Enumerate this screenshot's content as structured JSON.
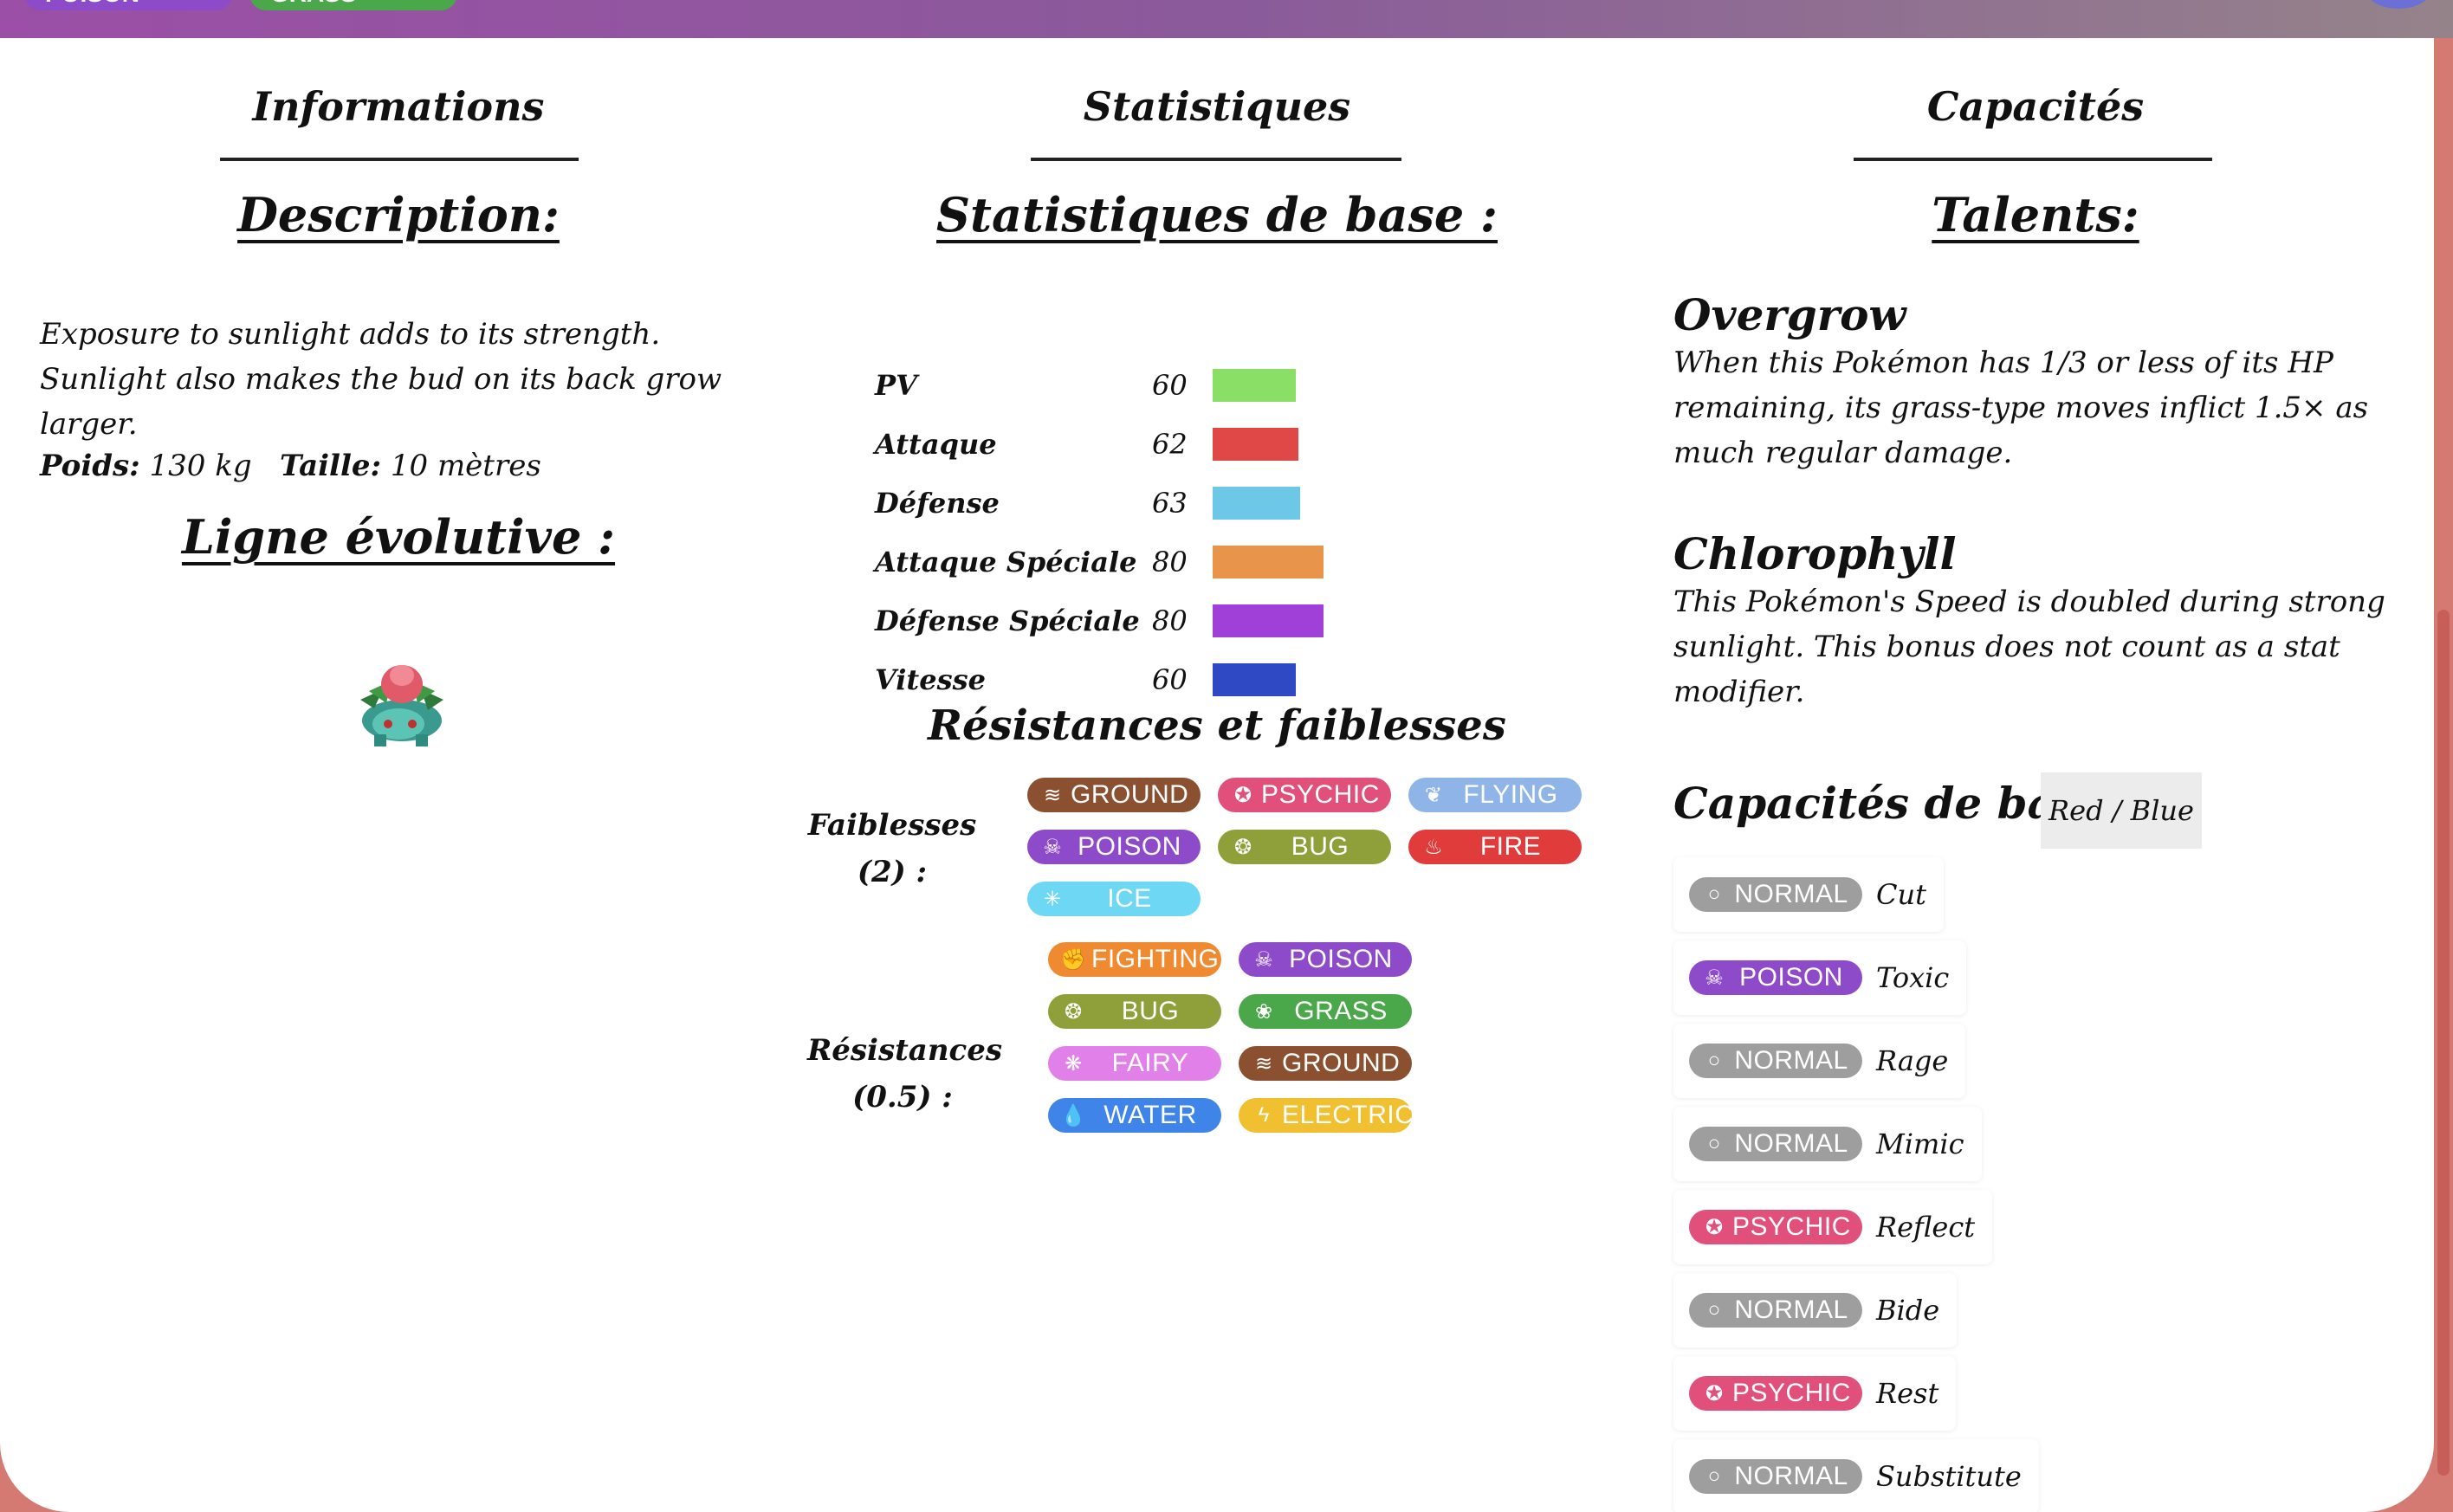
{
  "header": {
    "type_chips": [
      {
        "label": "POISON",
        "color": "#8e4bc9"
      },
      {
        "label": "GRASS",
        "color": "#4aa84a"
      }
    ]
  },
  "columns": {
    "info": {
      "title": "Informations",
      "description_title": "Description:",
      "description": "Exposure to sunlight adds to its strength. Sunlight also makes the bud on its back grow larger.",
      "weight_label": "Poids:",
      "weight_value": "130 kg",
      "height_label": "Taille:",
      "height_value": "10 mètres",
      "evolution_title": "Ligne évolutive :"
    },
    "stats": {
      "title": "Statistiques",
      "base_title": "Statistiques de base :",
      "rows": [
        {
          "name": "PV",
          "value": "60",
          "color": "#8ae066"
        },
        {
          "name": "Attaque",
          "value": "62",
          "color": "#e04848"
        },
        {
          "name": "Défense",
          "value": "63",
          "color": "#6cc8e6"
        },
        {
          "name": "Attaque Spéciale",
          "value": "80",
          "color": "#e8944a"
        },
        {
          "name": "Défense Spéciale",
          "value": "80",
          "color": "#a040d8"
        },
        {
          "name": "Vitesse",
          "value": "60",
          "color": "#2f48c4"
        }
      ],
      "res_title": "Résistances et faiblesses",
      "weak_label_1": "Faiblesses",
      "weak_label_2": "(2) :",
      "weaknesses": [
        {
          "label": "GROUND",
          "color": "#8a5030",
          "icon": "ground-icon"
        },
        {
          "label": "PSYCHIC",
          "color": "#e0507a",
          "icon": "psychic-icon"
        },
        {
          "label": "FLYING",
          "color": "#8fb4e8",
          "icon": "flying-icon"
        },
        {
          "label": "POISON",
          "color": "#8e4bc9",
          "icon": "poison-icon"
        },
        {
          "label": "BUG",
          "color": "#8fa03a",
          "icon": "bug-icon"
        },
        {
          "label": "FIRE",
          "color": "#e03c3c",
          "icon": "fire-icon"
        },
        {
          "label": "ICE",
          "color": "#6ed8f4",
          "icon": "ice-icon"
        }
      ],
      "resist_label_1": "Résistances",
      "resist_label_2": "(0.5) :",
      "resistances": [
        {
          "label": "FIGHTING",
          "color": "#f08a30",
          "icon": "fighting-icon"
        },
        {
          "label": "POISON",
          "color": "#8e4bc9",
          "icon": "poison-icon"
        },
        {
          "label": "BUG",
          "color": "#8fa03a",
          "icon": "bug-icon"
        },
        {
          "label": "GRASS",
          "color": "#4aa84a",
          "icon": "grass-icon"
        },
        {
          "label": "FAIRY",
          "color": "#e080e8",
          "icon": "fairy-icon"
        },
        {
          "label": "GROUND",
          "color": "#8a5030",
          "icon": "ground-icon"
        },
        {
          "label": "WATER",
          "color": "#3f84e8",
          "icon": "water-icon"
        },
        {
          "label": "ELECTRIC",
          "color": "#f0c030",
          "icon": "electric-icon"
        }
      ]
    },
    "abilities": {
      "title": "Capacités",
      "talents_title": "Talents:",
      "talents": [
        {
          "name": "Overgrow",
          "desc": "When this Pokémon has 1/3 or less of its HP remaining, its grass-type moves inflict 1.5× as much regular damage."
        },
        {
          "name": "Chlorophyll",
          "desc": "This Pokémon's Speed is doubled during strong sunlight. This bonus does not count as a stat modifier."
        }
      ],
      "moves_title": "Capacités de base :",
      "version_button": "Red / Blue",
      "moves": [
        {
          "type": "NORMAL",
          "color": "#9e9e9e",
          "icon": "normal-icon",
          "name": "Cut"
        },
        {
          "type": "POISON",
          "color": "#8e4bc9",
          "icon": "poison-icon",
          "name": "Toxic"
        },
        {
          "type": "NORMAL",
          "color": "#9e9e9e",
          "icon": "normal-icon",
          "name": "Rage"
        },
        {
          "type": "NORMAL",
          "color": "#9e9e9e",
          "icon": "normal-icon",
          "name": "Mimic"
        },
        {
          "type": "PSYCHIC",
          "color": "#e0507a",
          "icon": "psychic-icon",
          "name": "Reflect"
        },
        {
          "type": "NORMAL",
          "color": "#9e9e9e",
          "icon": "normal-icon",
          "name": "Bide"
        },
        {
          "type": "PSYCHIC",
          "color": "#e0507a",
          "icon": "psychic-icon",
          "name": "Rest"
        },
        {
          "type": "NORMAL",
          "color": "#9e9e9e",
          "icon": "normal-icon",
          "name": "Substitute"
        }
      ]
    }
  }
}
